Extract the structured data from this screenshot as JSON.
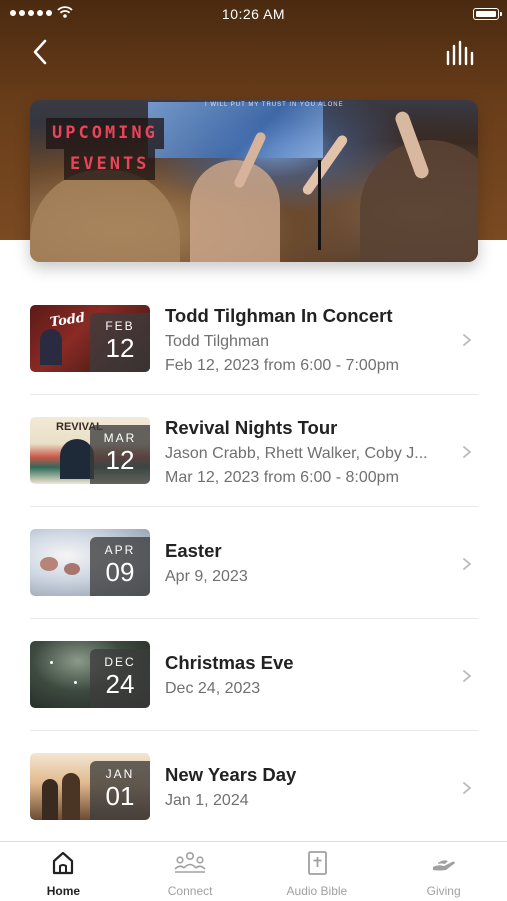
{
  "status_bar": {
    "time": "10:26 AM"
  },
  "header": {
    "back_icon": "chevron-left-icon",
    "audio_icon": "equalizer-icon"
  },
  "hero": {
    "line1": "UPCOMING",
    "line2": "EVENTS",
    "screen_caption": "I WILL PUT MY TRUST IN YOU ALONE"
  },
  "events": [
    {
      "title": "Todd Tilghman In Concert",
      "subtitle": "Todd Tilghman",
      "datetime": "Feb 12, 2023 from 6:00 - 7:00pm",
      "month": "FEB",
      "day": "12",
      "thumb_text": "Todd"
    },
    {
      "title": "Revival Nights Tour",
      "subtitle": "Jason Crabb, Rhett Walker, Coby J...",
      "datetime": "Mar 12, 2023 from 6:00 - 8:00pm",
      "month": "MAR",
      "day": "12",
      "thumb_text": "REVIVAL"
    },
    {
      "title": "Easter",
      "subtitle": "Apr 9, 2023",
      "month": "APR",
      "day": "09"
    },
    {
      "title": "Christmas Eve",
      "subtitle": "Dec 24, 2023",
      "month": "DEC",
      "day": "24"
    },
    {
      "title": "New Years Day",
      "subtitle": "Jan 1, 2024",
      "month": "JAN",
      "day": "01"
    }
  ],
  "tabbar": {
    "tabs": [
      {
        "label": "Home",
        "icon": "home-icon",
        "active": true
      },
      {
        "label": "Connect",
        "icon": "people-icon",
        "active": false
      },
      {
        "label": "Audio Bible",
        "icon": "bible-icon",
        "active": false
      },
      {
        "label": "Giving",
        "icon": "giving-hand-icon",
        "active": false
      }
    ]
  }
}
